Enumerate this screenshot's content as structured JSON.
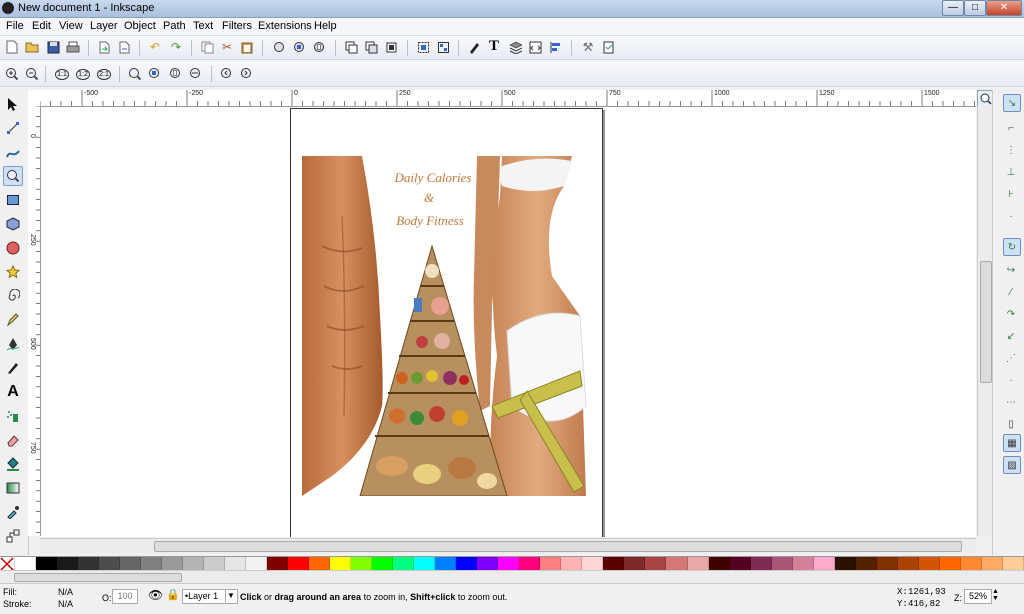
{
  "window": {
    "title": "New document 1 - Inkscape",
    "buttons": {
      "minimize": "—",
      "maximize": "□",
      "close": "✕"
    }
  },
  "menu": [
    {
      "label": "File"
    },
    {
      "label": "Edit"
    },
    {
      "label": "View"
    },
    {
      "label": "Layer"
    },
    {
      "label": "Object"
    },
    {
      "label": "Path"
    },
    {
      "label": "Text"
    },
    {
      "label": "Filters"
    },
    {
      "label": "Extensions"
    },
    {
      "label": "Help"
    }
  ],
  "commands_toolbar": [
    "new-document-icon",
    "open-icon",
    "save-icon",
    "print-icon",
    "import-icon",
    "export-icon",
    "undo-icon",
    "redo-icon",
    "copy-icon",
    "cut-icon",
    "paste-icon",
    "zoom-selection-icon",
    "zoom-drawing-icon",
    "zoom-page-icon",
    "duplicate-icon",
    "clone-icon",
    "unlink-clone-icon",
    "group-icon",
    "ungroup-icon",
    "fill-stroke-icon",
    "text-font-icon",
    "layers-icon",
    "xml-editor-icon",
    "align-icon",
    "preferences-icon",
    "document-properties-icon"
  ],
  "zoom_toolbar": [
    "zoom-in-icon",
    "zoom-out-icon",
    "zoom-1-1-icon",
    "zoom-1-2-icon",
    "zoom-2-1-icon",
    "zoom-selection-icon",
    "zoom-drawing-icon",
    "zoom-page-icon",
    "zoom-page-width-icon",
    "zoom-previous-icon",
    "zoom-next-icon"
  ],
  "tool_labels": {
    "zoom_1_1": "1:1",
    "zoom_1_2": "1:2",
    "zoom_2_1": "2:1",
    "text_tool": "A",
    "text_cmd": "T"
  },
  "tools": [
    "selector-tool-icon",
    "node-tool-icon",
    "tweak-tool-icon",
    "zoom-tool-icon",
    "rectangle-tool-icon",
    "3dbox-tool-icon",
    "ellipse-tool-icon",
    "star-tool-icon",
    "spiral-tool-icon",
    "pencil-tool-icon",
    "pen-tool-icon",
    "calligraphy-tool-icon",
    "text-tool-icon",
    "spray-tool-icon",
    "eraser-tool-icon",
    "paint-bucket-tool-icon",
    "gradient-tool-icon",
    "dropper-tool-icon",
    "connector-tool-icon"
  ],
  "ruler": {
    "h_labels": [
      "-500",
      "-250",
      "0",
      "250",
      "500",
      "750",
      "1000",
      "1250",
      "1500"
    ],
    "v_labels": [
      "0",
      "250",
      "500",
      "750",
      "1000",
      "1250"
    ]
  },
  "artwork": {
    "title_lines": [
      "Daily Calories",
      "&",
      "Body Fitness"
    ]
  },
  "palette": [
    "#ffffff",
    "#000000",
    "#1a1a1a",
    "#333333",
    "#4d4d4d",
    "#666666",
    "#808080",
    "#999999",
    "#b3b3b3",
    "#cccccc",
    "#e6e6e6",
    "#f2f2f2",
    "#800000",
    "#ff0000",
    "#ff6600",
    "#ffff00",
    "#80ff00",
    "#00ff00",
    "#00ff80",
    "#00ffff",
    "#0080ff",
    "#0000ff",
    "#8000ff",
    "#ff00ff",
    "#ff0080",
    "#ff8080",
    "#ffb3b3",
    "#ffd5d5",
    "#5a0000",
    "#7f2a2a",
    "#aa4444",
    "#d47777",
    "#e9a8a8",
    "#400000",
    "#550022",
    "#802b55",
    "#aa5577",
    "#d48099",
    "#ffaacc",
    "#2b1100",
    "#552200",
    "#803300",
    "#aa4400",
    "#d45500",
    "#ff6600",
    "#ff8833",
    "#ffaa66",
    "#ffcc99"
  ],
  "status": {
    "fill_label": "Fill:",
    "fill_value": "N/A",
    "stroke_label": "Stroke:",
    "stroke_value": "N/A",
    "opacity_label": "O:",
    "opacity_value": "100",
    "layer": "•Layer 1",
    "message_bold1": "Click",
    "message_part1": " or ",
    "message_bold2": "drag around an area",
    "message_part2": " to zoom in, ",
    "message_bold3": "Shift+click",
    "message_part3": " to zoom out.",
    "x_label": "X:",
    "x_value": "1261,93",
    "y_label": "Y:",
    "y_value": "416,82",
    "z_label": "Z:",
    "zoom_value": "52%"
  }
}
